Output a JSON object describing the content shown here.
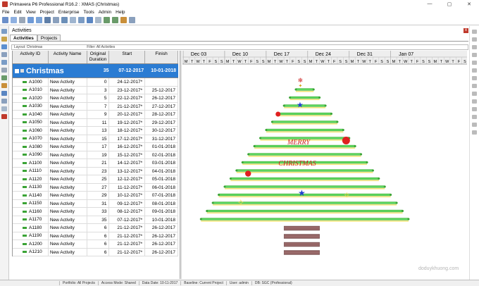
{
  "window": {
    "title": "Primavera P6 Professional R16.2 : XMAS (Christmas)",
    "minimize": "—",
    "maximize": "▢",
    "close": "✕"
  },
  "menu": [
    "File",
    "Edit",
    "View",
    "Project",
    "Enterprise",
    "Tools",
    "Admin",
    "Help"
  ],
  "panel": {
    "title": "Activities",
    "close": "x"
  },
  "tabs": [
    "Activities",
    "Projects"
  ],
  "filterbar": {
    "layout": "Layout: Christmas",
    "filter": "Filter: All Activities"
  },
  "columns": [
    {
      "label": "Activity ID"
    },
    {
      "label": "Activity Name"
    },
    {
      "label": "Original Duration"
    },
    {
      "label": "Start"
    },
    {
      "label": "Finish"
    }
  ],
  "wbs": {
    "name": "Christmas",
    "duration": "35",
    "start": "07-12-2017",
    "finish": "10-01-2018"
  },
  "rows": [
    {
      "id": "A1000",
      "name": "New Activity",
      "dur": "0",
      "start": "24-12-2017*",
      "finish": ""
    },
    {
      "id": "A1010",
      "name": "New Activity",
      "dur": "3",
      "start": "23-12-2017*",
      "finish": "25-12-2017"
    },
    {
      "id": "A1020",
      "name": "New Activity",
      "dur": "5",
      "start": "22-12-2017*",
      "finish": "26-12-2017"
    },
    {
      "id": "A1030",
      "name": "New Activity",
      "dur": "7",
      "start": "21-12-2017*",
      "finish": "27-12-2017"
    },
    {
      "id": "A1040",
      "name": "New Activity",
      "dur": "9",
      "start": "20-12-2017*",
      "finish": "28-12-2017"
    },
    {
      "id": "A1050",
      "name": "New Activity",
      "dur": "11",
      "start": "19-12-2017*",
      "finish": "29-12-2017"
    },
    {
      "id": "A1060",
      "name": "New Activity",
      "dur": "13",
      "start": "18-12-2017*",
      "finish": "30-12-2017"
    },
    {
      "id": "A1070",
      "name": "New Activity",
      "dur": "15",
      "start": "17-12-2017*",
      "finish": "31-12-2017"
    },
    {
      "id": "A1080",
      "name": "New Activity",
      "dur": "17",
      "start": "16-12-2017*",
      "finish": "01-01-2018"
    },
    {
      "id": "A1090",
      "name": "New Activity",
      "dur": "19",
      "start": "15-12-2017*",
      "finish": "02-01-2018"
    },
    {
      "id": "A1100",
      "name": "New Activity",
      "dur": "21",
      "start": "14-12-2017*",
      "finish": "03-01-2018"
    },
    {
      "id": "A1110",
      "name": "New Activity",
      "dur": "23",
      "start": "13-12-2017*",
      "finish": "04-01-2018"
    },
    {
      "id": "A1120",
      "name": "New Activity",
      "dur": "25",
      "start": "12-12-2017*",
      "finish": "05-01-2018"
    },
    {
      "id": "A1130",
      "name": "New Activity",
      "dur": "27",
      "start": "11-12-2017*",
      "finish": "06-01-2018"
    },
    {
      "id": "A1140",
      "name": "New Activity",
      "dur": "29",
      "start": "10-12-2017*",
      "finish": "07-01-2018"
    },
    {
      "id": "A1150",
      "name": "New Activity",
      "dur": "31",
      "start": "09-12-2017*",
      "finish": "08-01-2018"
    },
    {
      "id": "A1160",
      "name": "New Activity",
      "dur": "33",
      "start": "08-12-2017*",
      "finish": "09-01-2018"
    },
    {
      "id": "A1170",
      "name": "New Activity",
      "dur": "35",
      "start": "07-12-2017*",
      "finish": "10-01-2018"
    },
    {
      "id": "A1180",
      "name": "New Activity",
      "dur": "6",
      "start": "21-12-2017*",
      "finish": "26-12-2017"
    },
    {
      "id": "A1190",
      "name": "New Activity",
      "dur": "6",
      "start": "21-12-2017*",
      "finish": "26-12-2017"
    },
    {
      "id": "A1200",
      "name": "New Activity",
      "dur": "6",
      "start": "21-12-2017*",
      "finish": "26-12-2017"
    },
    {
      "id": "A1210",
      "name": "New Activity",
      "dur": "6",
      "start": "21-12-2017*",
      "finish": "26-12-2017"
    }
  ],
  "timescale": {
    "weeks": [
      "Dec 03",
      "Dec 10",
      "Dec 17",
      "Dec 24",
      "Dec 31",
      "Jan 07"
    ],
    "days": "MTWTFSS"
  },
  "annotations": {
    "line1": "MERRY",
    "line2": "CHRISTMAS"
  },
  "colors": {
    "bar": "#5cd65c",
    "base": "#f2e57a",
    "trunk": "#8b5a5a",
    "accent": "#2b7cd3",
    "text": "#cc2222"
  },
  "statusbar": [
    "Portfolio: All Projects",
    "Access Mode: Shared",
    "Data Date: 10-11-2017",
    "Baseline: Current Project",
    "User: admin",
    "DB: SGC (Professional)"
  ],
  "watermark": "doduykhuong.com"
}
